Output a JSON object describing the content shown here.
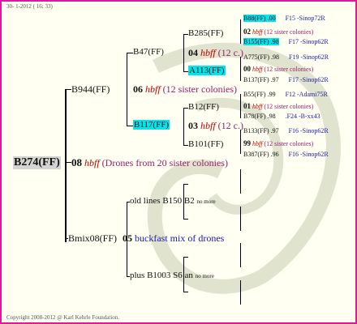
{
  "header": {
    "date": "30- 1-2012 ( 16: 33)"
  },
  "footer": {
    "copyright": "Copyright 2008-2012 @ Karl Kehrle Foundation."
  },
  "root": {
    "label": "B274(FF)"
  },
  "gen1": {
    "father": {
      "code": "08",
      "label": "hbff",
      "note": "(Drones from 20 sister colonies)"
    },
    "mother": {
      "label": "B944(FF)"
    }
  },
  "gen2": {
    "m_father": {
      "code": "06",
      "label": "hbff",
      "note": "(12 sister colonies)"
    },
    "m_mother": {
      "label": "B47(FF)"
    },
    "f_father_label": "B117(FF)",
    "bmix": {
      "label": "Bmix08(FF)",
      "code": "05",
      "note": "buckfast mix of drones"
    }
  },
  "gen3": {
    "b285": "B285(FF)",
    "b285_code": "04",
    "b285_label": "hbff",
    "b285_note": "(12 c.)",
    "a113": "A113(FF)",
    "b12": "B12(FF)",
    "b12_code": "03",
    "b12_label": "hbff",
    "b12_note": "(12 c.)",
    "b101": "B101(FF)",
    "old_lines": "old lines B150 B2",
    "old_suffix": "no more",
    "plus_b1003": "plus B1003 S6 an",
    "plus_suffix": "no more"
  },
  "gen4": [
    {
      "text": "B88(FF) .00",
      "right": "F15 -Sinop72R",
      "hl": true
    },
    {
      "text": "02",
      "ital": "hbff",
      "note": "(12 sister colonies)"
    },
    {
      "text": "B155(FF) .98",
      "right": "F17 -Sinop62R",
      "hl": true
    },
    {
      "text": "A775(FF) .98",
      "right": "F19 -Sinop62R"
    },
    {
      "text": "00",
      "ital": "hbff",
      "note": "(12 sister colonies)"
    },
    {
      "text": "B137(FF) .97",
      "right": "F17 -Sinop62R"
    },
    {
      "text": "B55(FF) .99",
      "right": "F12 -Adami75R"
    },
    {
      "text": "01",
      "ital": "hbff",
      "note": "(12 sister colonies)"
    },
    {
      "text": "B78(FF) .98",
      "right": ".F24 -B-xx43"
    },
    {
      "text": "B133(FF) .97",
      "right": "F16 -Sinop62R"
    },
    {
      "text": "99",
      "ital": "hbff",
      "note": "(12 sister colonies)"
    },
    {
      "text": "B387(FF) .96",
      "right": "F16 -Sinop62R"
    }
  ]
}
